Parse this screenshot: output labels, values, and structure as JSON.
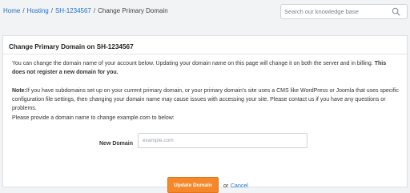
{
  "breadcrumb": {
    "items": [
      "Home",
      "Hosting",
      "SH-1234567"
    ],
    "current": "Change Primary Domain",
    "separator": "/"
  },
  "search": {
    "placeholder": "Search our knowledge base",
    "value": "",
    "icon": "search-icon"
  },
  "panel": {
    "title": "Change Primary Domain on SH-1234567",
    "intro_text": "You can change the domain name of your account below. Updating your domain name on this page will change it on both the server and in billing. ",
    "intro_bold": "This does not register a new domain for you.",
    "note_label": "Note:",
    "note_text": "If you have subdomains set up on your current primary domain, or your primary domain's site uses a CMS like WordPress or Joomla that uses specific configuration file settings, then changing your domain name may cause issues with accessing your site. Please contact us if you have any questions or problems.",
    "instruction": "Please provide a domain name to change example.com to below:"
  },
  "form": {
    "label": "New Domain",
    "placeholder": "example.com",
    "value": ""
  },
  "actions": {
    "update_label": "Update Domain",
    "or_text": "or",
    "cancel_label": "Cancel"
  },
  "colors": {
    "link": "#1a73c8",
    "accent": "#f5882a",
    "background": "#f2f3f5"
  }
}
